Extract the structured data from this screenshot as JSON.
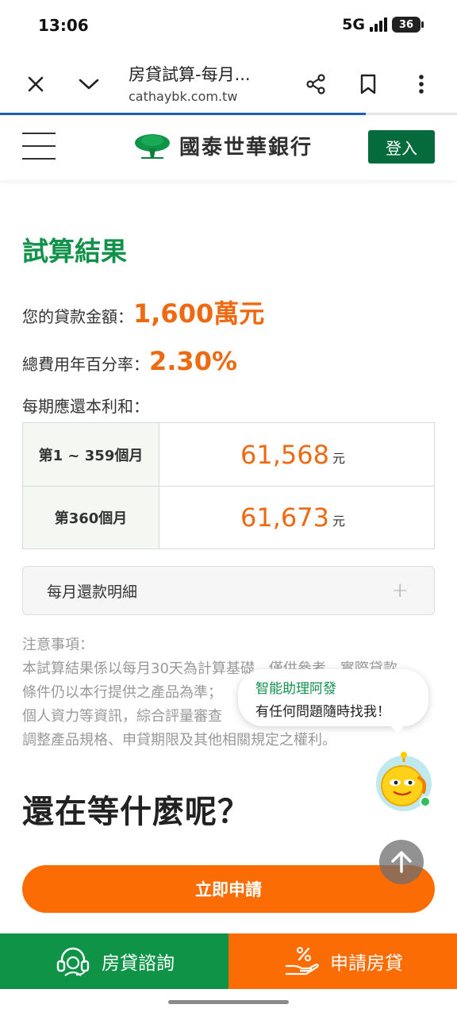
{
  "status_bar": {
    "time": "13:06",
    "network": "5G",
    "battery": "36"
  },
  "browser": {
    "page_title": "房貸試算-每月...",
    "url": "cathaybk.com.tw",
    "load_progress": 0.8
  },
  "header": {
    "brand_name": "國泰世華銀行",
    "login_label": "登入"
  },
  "result": {
    "title": "試算結果",
    "loan_amount_label": "您的貸款金額：",
    "loan_amount_value": "1,600萬元",
    "apr_label": "總費用年百分率：",
    "apr_value": "2.30%",
    "payment_label": "每期應還本利和：",
    "payments": [
      {
        "period": "第1 ~ 359個月",
        "amount": "61,568",
        "unit": "元"
      },
      {
        "period": "第360個月",
        "amount": "61,673",
        "unit": "元"
      }
    ],
    "detail_label": "每月還款明細",
    "detail_icon": "+"
  },
  "notice": {
    "title": "注意事項：",
    "lines": [
      "本試算結果係以每月30天為計算基礎，僅供參考，實際貸款",
      "條件仍以本行提供之產品為準；",
      "個人資力等資訊，綜合評量審查",
      "調整產品規格、申貸期限及其他相關規定之權利。"
    ]
  },
  "cta": {
    "heading": "還在等什麼呢？",
    "apply_label": "立即申請"
  },
  "chat": {
    "title": "智能助理阿發",
    "message": "有任何問題隨時找我！"
  },
  "bottom_bar": {
    "consult_label": "房貸諮詢",
    "apply_label": "申請房貸"
  },
  "colors": {
    "brand_green": "#066b3c",
    "title_green": "#12914b",
    "accent_orange": "#fb6c05",
    "value_orange": "#ee6a12"
  },
  "icons": [
    "close-icon",
    "chevron-down-icon",
    "share-icon",
    "bookmark-icon",
    "more-vert-icon",
    "menu-icon",
    "tree-logo-icon",
    "plus-icon",
    "chatbot-avatar-icon",
    "arrow-up-icon",
    "headset-icon",
    "hand-percent-icon"
  ]
}
